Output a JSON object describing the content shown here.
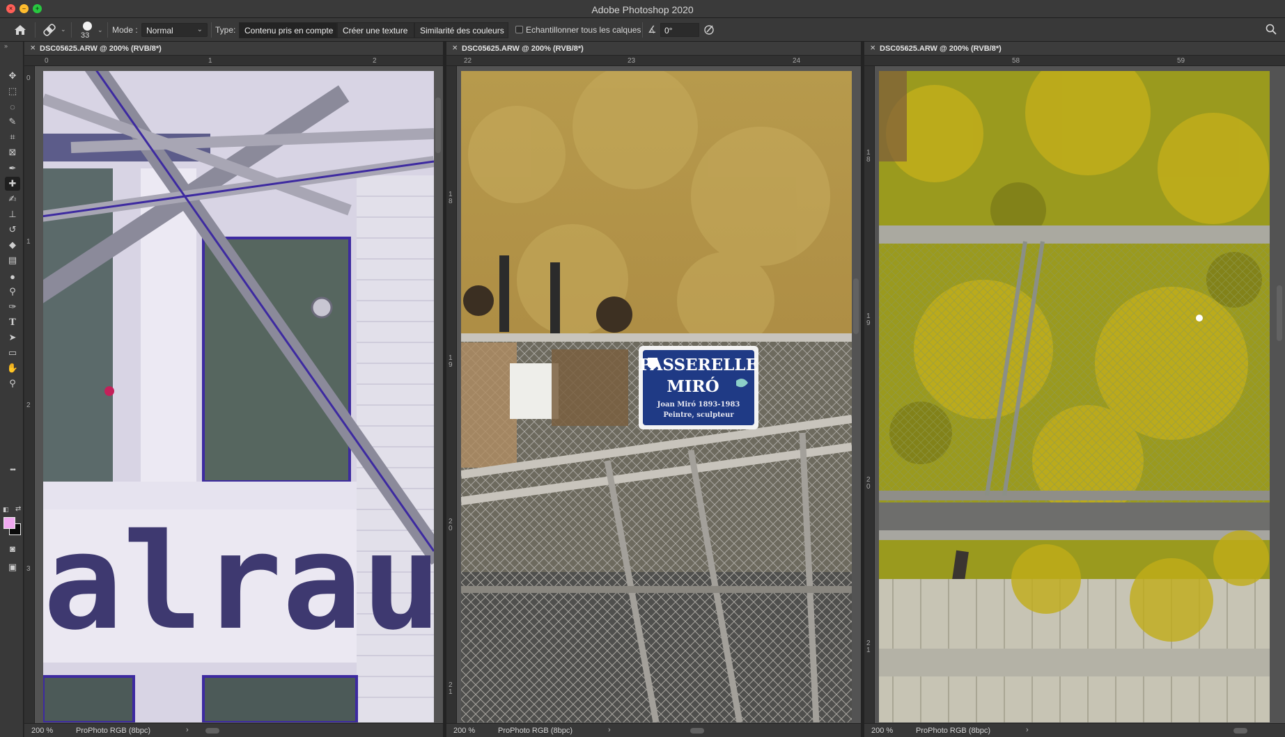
{
  "app": {
    "window_title": "Adobe Photoshop 2020"
  },
  "options_bar": {
    "brush_size": "33",
    "mode_label": "Mode :",
    "mode_value": "Normal",
    "type_label": "Type:",
    "type_options": [
      "Contenu pris en compte",
      "Créer une texture",
      "Similarité des couleurs"
    ],
    "sample_all_layers_label": "Echantillonner tous les calques",
    "sample_all_layers_checked": false,
    "angle_value": "0°"
  },
  "tools": [
    {
      "name": "move-tool",
      "glyph": "✥"
    },
    {
      "name": "marquee-tool",
      "glyph": "⬚"
    },
    {
      "name": "lasso-tool",
      "glyph": "◌"
    },
    {
      "name": "quick-selection-tool",
      "glyph": "✎"
    },
    {
      "name": "crop-tool",
      "glyph": "⌗"
    },
    {
      "name": "frame-tool",
      "glyph": "⊠"
    },
    {
      "name": "eyedropper-tool",
      "glyph": "✒"
    },
    {
      "name": "spot-healing-tool",
      "glyph": "✚"
    },
    {
      "name": "brush-tool",
      "glyph": "✍"
    },
    {
      "name": "clone-stamp-tool",
      "glyph": "⊥"
    },
    {
      "name": "history-brush-tool",
      "glyph": "↺"
    },
    {
      "name": "eraser-tool",
      "glyph": "◆"
    },
    {
      "name": "gradient-tool",
      "glyph": "▤"
    },
    {
      "name": "blur-tool",
      "glyph": "●"
    },
    {
      "name": "dodge-tool",
      "glyph": "⚲"
    },
    {
      "name": "pen-tool",
      "glyph": "✑"
    },
    {
      "name": "type-tool",
      "glyph": "T"
    },
    {
      "name": "path-selection-tool",
      "glyph": "➤"
    },
    {
      "name": "rectangle-tool",
      "glyph": "▭"
    },
    {
      "name": "hand-tool",
      "glyph": "✋"
    },
    {
      "name": "zoom-tool",
      "glyph": "⚲"
    },
    {
      "name": "more-tools",
      "glyph": "•••"
    }
  ],
  "colors": {
    "foreground": "#f0a9f0",
    "background": "#0a0a0a"
  },
  "documents": [
    {
      "tab_title": "DSC05625.ARW @ 200% (RVB/8*)",
      "ruler_h": [
        "0",
        "1",
        "2"
      ],
      "ruler_v": [
        "0",
        "1",
        "2",
        "3"
      ],
      "zoom": "200 %",
      "profile": "ProPhoto RGB (8bpc)",
      "canvas_text": "alrau"
    },
    {
      "tab_title": "DSC05625.ARW @ 200% (RVB/8*)",
      "ruler_h": [
        "22",
        "23",
        "24"
      ],
      "ruler_v": [
        "1 8",
        "1 9",
        "2 0",
        "2 1"
      ],
      "zoom": "200 %",
      "profile": "ProPhoto RGB (8bpc)",
      "sign_line1": "PASSERELLE",
      "sign_line2": "MIRÓ",
      "sign_line3": "Joan Miró 1893-1983",
      "sign_line4": "Peintre, sculpteur"
    },
    {
      "tab_title": "DSC05625.ARW @ 200% (RVB/8*)",
      "ruler_h": [
        "58",
        "59"
      ],
      "ruler_v": [
        "1 8",
        "1 9",
        "2 0",
        "2 1"
      ],
      "zoom": "200 %",
      "profile": "ProPhoto RGB (8bpc)"
    }
  ]
}
